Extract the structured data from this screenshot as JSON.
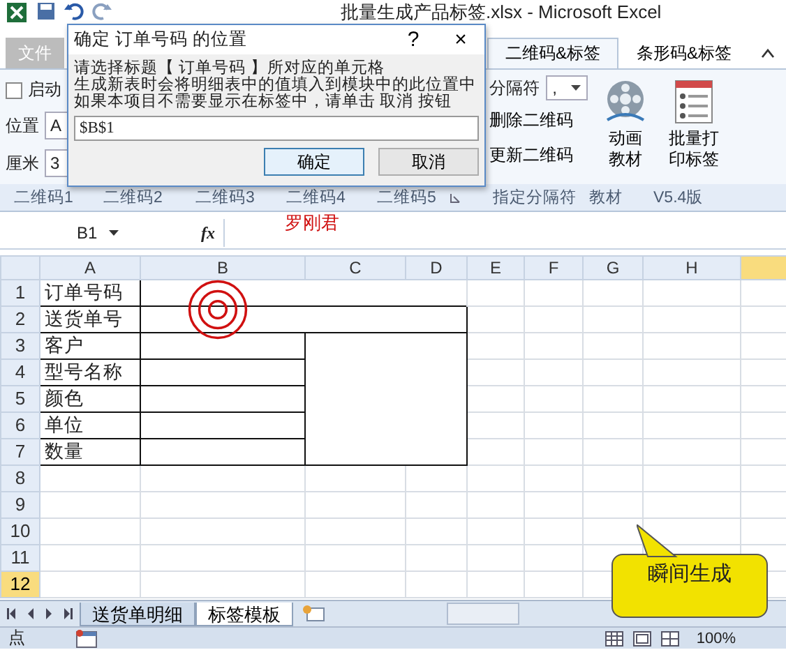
{
  "window": {
    "title": "批量生成产品标签.xlsx - Microsoft Excel"
  },
  "ribbon": {
    "tabs": [
      {
        "label": "文件",
        "kind": "file",
        "selected": false
      },
      {
        "label": "二维码&标签",
        "kind": "tab",
        "selected": true
      },
      {
        "label": "条形码&标签",
        "kind": "tab",
        "selected": false
      }
    ],
    "startup": {
      "label": "启动",
      "checked": false
    },
    "position": {
      "label": "位置",
      "value": "A"
    },
    "cm": {
      "label": "厘米",
      "value": "3"
    },
    "separator": {
      "label": "分隔符",
      "value": ","
    },
    "small_buttons": [
      "删除二维码",
      "更新二维码"
    ],
    "large_buttons": [
      {
        "kind": "film",
        "lines": [
          "动画",
          "教材"
        ]
      },
      {
        "kind": "list",
        "lines": [
          "批量打",
          "印标签"
        ]
      }
    ],
    "groups": [
      {
        "label": "二维码1",
        "launcher": false
      },
      {
        "label": "二维码2",
        "launcher": false
      },
      {
        "label": "二维码3",
        "launcher": false
      },
      {
        "label": "二维码4",
        "launcher": false
      },
      {
        "label": "二维码5",
        "launcher": true
      },
      {
        "label": "指定分隔符",
        "launcher": false
      },
      {
        "label": "教材",
        "launcher": false
      },
      {
        "label": "V5.4版",
        "launcher": false
      }
    ]
  },
  "dialog": {
    "title": "确定 订单号码 的位置",
    "help": "?",
    "close": "×",
    "message": [
      "请选择标题【 订单号码 】所对应的单元格",
      "生成新表时会将明细表中的值填入到模块中的此位置中",
      "如果本项目不需要显示在标签中，请单击 取消 按钮"
    ],
    "value": "$B$1",
    "buttons": [
      {
        "label": "确定",
        "default": true
      },
      {
        "label": "取消",
        "default": false
      }
    ]
  },
  "formula_bar": {
    "name_box": "B1",
    "fx": "fx"
  },
  "author_note": "罗刚君",
  "sheet": {
    "columns": [
      {
        "label": "A",
        "selected": false
      },
      {
        "label": "B",
        "selected": false
      },
      {
        "label": "C",
        "selected": false
      },
      {
        "label": "D",
        "selected": false
      },
      {
        "label": "E",
        "selected": false
      },
      {
        "label": "F",
        "selected": false
      },
      {
        "label": "G",
        "selected": false
      },
      {
        "label": "H",
        "selected": false
      },
      {
        "selected": true
      }
    ],
    "rows": [
      {
        "label": "1",
        "selected": false,
        "cells": [
          "订单号码"
        ]
      },
      {
        "label": "2",
        "selected": false,
        "cells": [
          "送货单号"
        ]
      },
      {
        "label": "3",
        "selected": false,
        "cells": [
          "客户"
        ]
      },
      {
        "label": "4",
        "selected": false,
        "cells": [
          "型号名称"
        ]
      },
      {
        "label": "5",
        "selected": false,
        "cells": [
          "颜色"
        ]
      },
      {
        "label": "6",
        "selected": false,
        "cells": [
          "单位"
        ]
      },
      {
        "label": "7",
        "selected": false,
        "cells": [
          "数量"
        ]
      },
      {
        "label": "8",
        "selected": false,
        "cells": []
      },
      {
        "label": "9",
        "selected": false,
        "cells": []
      },
      {
        "label": "10",
        "selected": false,
        "cells": []
      },
      {
        "label": "11",
        "selected": false,
        "cells": []
      },
      {
        "label": "12",
        "selected": true,
        "cells": []
      }
    ]
  },
  "sheet_tabs": [
    {
      "label": "送货单明细",
      "selected": false
    },
    {
      "label": "标签模板",
      "selected": true
    }
  ],
  "callout": "瞬间生成",
  "status_bar": {
    "text": "点",
    "zoom": "100%"
  }
}
